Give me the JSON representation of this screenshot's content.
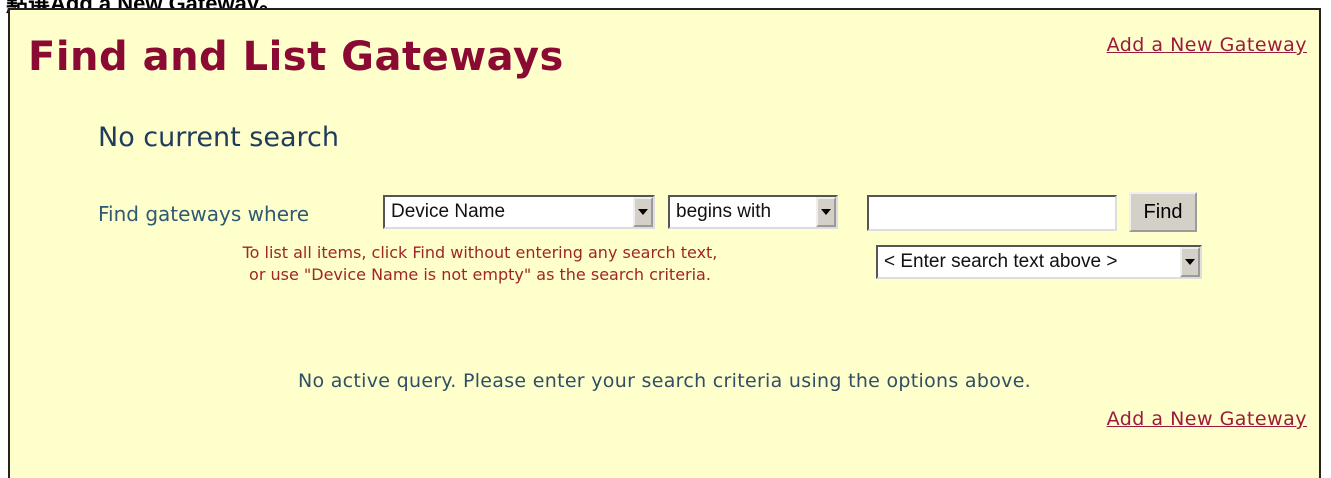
{
  "caption": "點選Add a New Gateway。",
  "page": {
    "title": "Find and List Gateways",
    "add_link_top": "Add a New Gateway",
    "add_link_bottom": "Add a New Gateway",
    "subhead": "No current search",
    "status": "No active query. Please enter your search criteria using the options above."
  },
  "search": {
    "label": "Find gateways where",
    "field": "Device Name",
    "operator": "begins with",
    "text_value": "",
    "find_label": "Find",
    "hint_select": "< Enter search text above >",
    "help_line1": "To list all items, click Find without entering any search text,",
    "help_line2": "or use \"Device Name is not empty\" as the search criteria."
  },
  "colors": {
    "panel_bg": "#ffffcc",
    "title": "#8b0a33",
    "link": "#9b1a3e",
    "help": "#a02626"
  }
}
